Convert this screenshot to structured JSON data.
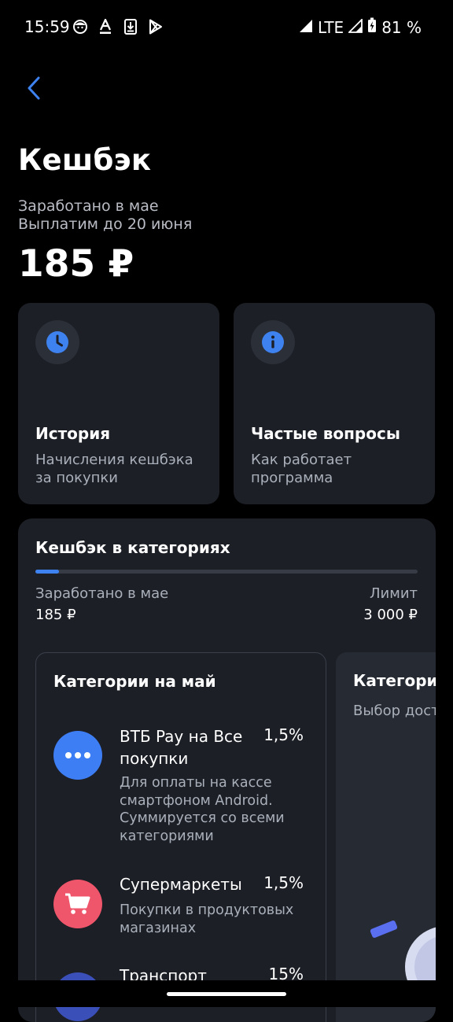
{
  "status_bar": {
    "time": "15:59",
    "network": "LTE",
    "battery": "81 %",
    "icons": [
      "face-icon",
      "font-icon",
      "download-icon",
      "play-store-icon",
      "signal-icon",
      "signal-icon",
      "battery-charging-icon"
    ]
  },
  "header": {
    "title": "Кешбэк",
    "subtitle_line1": "Заработано в мае",
    "subtitle_line2": "Выплатим до 20 июня",
    "amount": "185 ₽"
  },
  "cards": [
    {
      "title": "История",
      "description": "Начисления кешбэка за покупки",
      "icon": "clock-icon"
    },
    {
      "title": "Частые вопросы",
      "description": "Как работает программа",
      "icon": "info-icon"
    }
  ],
  "categories_section": {
    "title": "Кешбэк в категориях",
    "progress": 0.0617,
    "earned_label": "Заработано в мае",
    "earned_value": "185 ₽",
    "limit_label": "Лимит",
    "limit_value": "3 000 ₽",
    "month_card": {
      "title": "Категории на май",
      "items": [
        {
          "name": "ВТБ Pay на Все покупки",
          "percent": "1,5%",
          "description": "Для оплаты на кассе смартфоном Android. Суммируется со всеми категориями",
          "icon": "more-dots-icon",
          "color": "#3e7ef5"
        },
        {
          "name": "Супермаркеты",
          "percent": "1,5%",
          "description": "Покупки в продуктовых магазинах",
          "icon": "cart-icon",
          "color": "#f0566b"
        },
        {
          "name": "Транспорт",
          "percent": "15%",
          "description": "",
          "icon": "transport-icon",
          "color": "#3b4fb8"
        }
      ]
    },
    "choice_card": {
      "title": "Категории",
      "subtitle": "Выбор дост"
    }
  },
  "colors": {
    "background": "#000000",
    "card": "#1c1f26",
    "accent": "#3e82f0"
  }
}
